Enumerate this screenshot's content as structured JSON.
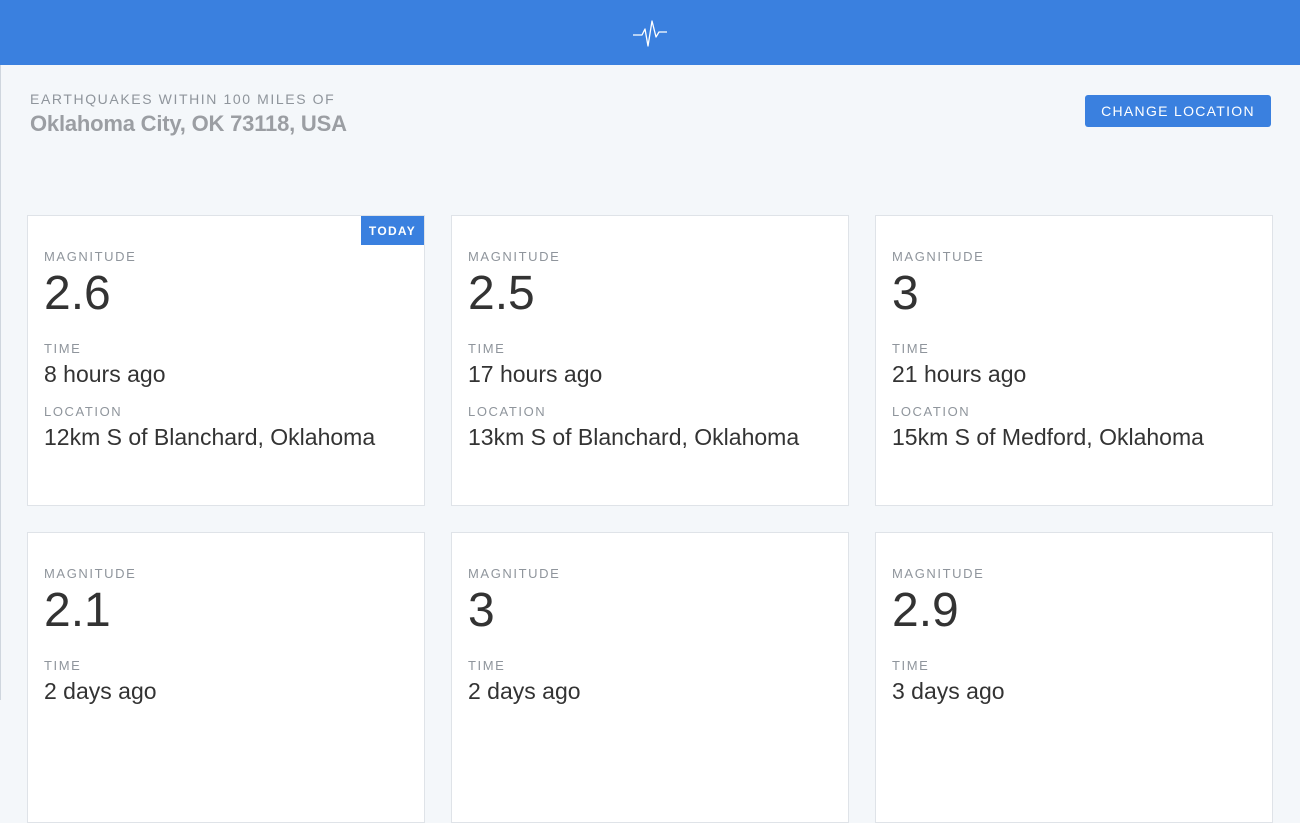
{
  "header": {
    "icon": "pulse-icon",
    "kicker": "EARTHQUAKES WITHIN 100 MILES OF",
    "location": "Oklahoma City, OK 73118, USA",
    "change_location_label": "CHANGE LOCATION"
  },
  "colors": {
    "accent": "#3a80df",
    "background": "#f4f7fa",
    "card": "#ffffff"
  },
  "labels": {
    "magnitude": "MAGNITUDE",
    "time": "TIME",
    "location": "LOCATION"
  },
  "quakes": [
    {
      "badge": "TODAY",
      "magnitude": "2.6",
      "time": "8 hours ago",
      "location": "12km S of Blanchard, Oklahoma"
    },
    {
      "badge": "",
      "magnitude": "2.5",
      "time": "17 hours ago",
      "location": "13km S of Blanchard, Oklahoma"
    },
    {
      "badge": "",
      "magnitude": "3",
      "time": "21 hours ago",
      "location": "15km S of Medford, Oklahoma"
    },
    {
      "badge": "",
      "magnitude": "2.1",
      "time": "2 days ago",
      "location": ""
    },
    {
      "badge": "",
      "magnitude": "3",
      "time": "2 days ago",
      "location": ""
    },
    {
      "badge": "",
      "magnitude": "2.9",
      "time": "3 days ago",
      "location": ""
    }
  ]
}
